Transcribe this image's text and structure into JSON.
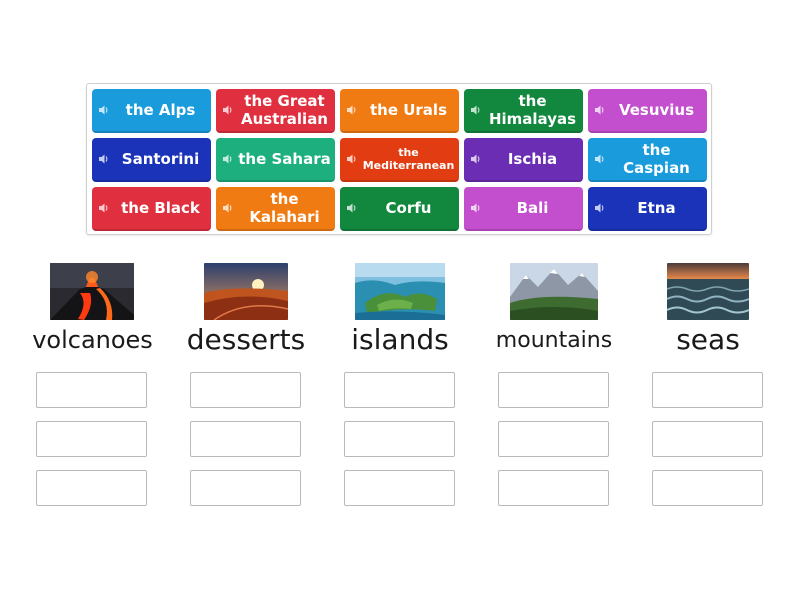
{
  "tiles": [
    {
      "label": "the Alps",
      "color": "#1a9bdc"
    },
    {
      "label": "the Great Australian",
      "color": "#e0303f"
    },
    {
      "label": "the Urals",
      "color": "#f07b12"
    },
    {
      "label": "the Himalayas",
      "color": "#11883e"
    },
    {
      "label": "Vesuvius",
      "color": "#c34fcf"
    },
    {
      "label": "Santorini",
      "color": "#1a33b8"
    },
    {
      "label": "the Sahara",
      "color": "#1daf7d"
    },
    {
      "label": "the Mediterranean",
      "color": "#e23d12"
    },
    {
      "label": "Ischia",
      "color": "#6a2db3"
    },
    {
      "label": "the Caspian",
      "color": "#1a9bdc"
    },
    {
      "label": "the Black",
      "color": "#e0303f"
    },
    {
      "label": "the Kalahari",
      "color": "#f07b12"
    },
    {
      "label": "Corfu",
      "color": "#11883e"
    },
    {
      "label": "Bali",
      "color": "#c34fcf"
    },
    {
      "label": "Etna",
      "color": "#1a33b8"
    }
  ],
  "categories": [
    {
      "label": "volcanoes",
      "image": "volcano"
    },
    {
      "label": "desserts",
      "image": "desert"
    },
    {
      "label": "islands",
      "image": "island"
    },
    {
      "label": "mountains",
      "image": "mountain"
    },
    {
      "label": "seas",
      "image": "sea"
    }
  ],
  "icons": {
    "tile_icon": "speaker-icon"
  }
}
